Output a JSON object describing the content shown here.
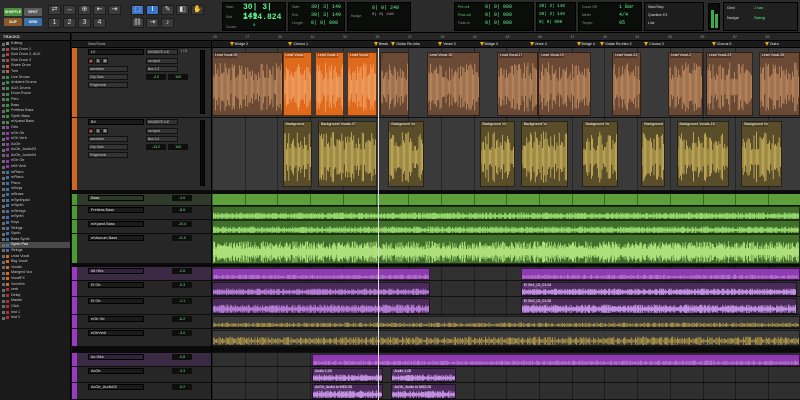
{
  "toolbar": {
    "modes": [
      {
        "label": "SHUFFLE",
        "color": "#4a8f3a"
      },
      {
        "label": "SPOT",
        "color": "#6a6a6a"
      },
      {
        "label": "SLIP",
        "color": "#8a5a2a"
      },
      {
        "label": "GRID",
        "color": "#3a6fa8"
      }
    ],
    "tools": [
      "⇄",
      "↔",
      "⊕",
      "⇤",
      "⇥",
      "⬚",
      "I",
      "✎",
      "◧",
      "✋"
    ],
    "counter_main": "30| 3| 149",
    "counter_sub": "1:14.824",
    "main_label": "Main",
    "sub_label": "Sub",
    "cursor_label": "Cursor",
    "cursor_value": "0",
    "start_label": "Start",
    "end_label": "End",
    "length_label": "Length",
    "start_value": "30| 3| 149",
    "end_value": "30| 3| 149",
    "length_value": "0| 0| 000",
    "nudge_label": "Nudge",
    "nudge_value": "0| 0| 240",
    "preroll_label": "Pre-roll",
    "postroll_label": "Post-roll",
    "fadein_label": "Fade-in",
    "preroll_value": "0| 0| 000",
    "postroll_value": "0| 0| 000",
    "fadein_value": "0| 0| 000",
    "start2_value": "30| 3| 149",
    "end2_value": "30| 3| 149",
    "length2_value": "0| 0| 000",
    "countoff_label": "Count Off",
    "meter_label": "Meter",
    "tempo_label": "Tempo",
    "countoff_value": "1 Bar",
    "meter_value": "4/4",
    "tempo_value": "95",
    "tempo_field": "Tempo ♩",
    "startstop": "Start/Stop",
    "quantize": "Quantize E3",
    "link_label": "Link",
    "grid_label": "Grid",
    "grid_value": "1 bar",
    "nudge2_label": "Nudge",
    "nudge2_value": "Swing"
  },
  "tracks_header": "TRACKS",
  "tracklist": [
    {
      "name": "Editing",
      "color": "#888888"
    },
    {
      "name": "Kick Drum 1",
      "color": "#b04040"
    },
    {
      "name": "Kick Drum 2, AUX",
      "color": "#b04040"
    },
    {
      "name": "Kick Drum 3",
      "color": "#b04040"
    },
    {
      "name": "Snare Drum",
      "color": "#c06030"
    },
    {
      "name": "Tom",
      "color": "#c06030"
    },
    {
      "name": "Live Drums",
      "color": "#2f8f3f"
    },
    {
      "name": "Ambient Drums",
      "color": "#2f8f3f"
    },
    {
      "name": "AUX Drums",
      "color": "#2f8f3f"
    },
    {
      "name": "Drum Room",
      "color": "#2f8f3f"
    },
    {
      "name": "Perc",
      "color": "#2f8f3f"
    },
    {
      "name": "Bass",
      "color": "#3b8f3b"
    },
    {
      "name": "Fretless Bass",
      "color": "#3b8f3b"
    },
    {
      "name": "Synth Bass",
      "color": "#3b8f3b"
    },
    {
      "name": "mXpand Bass",
      "color": "#3b8f3b"
    },
    {
      "name": "Gtrs",
      "color": "#8a3aa0"
    },
    {
      "name": "eGtr Gtr",
      "color": "#8a3aa0"
    },
    {
      "name": "eGtr Verb",
      "color": "#8a3aa0"
    },
    {
      "name": "AcGtr",
      "color": "#8a3aa0"
    },
    {
      "name": "AcGtr_Audio03",
      "color": "#8a3aa0"
    },
    {
      "name": "AcGtr_Audio04",
      "color": "#8a3aa0"
    },
    {
      "name": "eGtr Gtr",
      "color": "#8a3aa0"
    },
    {
      "name": "eKit Verb",
      "color": "#8a3aa0"
    },
    {
      "name": "mPiano",
      "color": "#3a6fb0"
    },
    {
      "name": "mPiano",
      "color": "#3a6fb0"
    },
    {
      "name": "Piano",
      "color": "#3a6fb0"
    },
    {
      "name": "mKeys",
      "color": "#3a6fb0"
    },
    {
      "name": "mBrass",
      "color": "#3a6fb0"
    },
    {
      "name": "mSynthpad",
      "color": "#3a6fb0"
    },
    {
      "name": "mSynth",
      "color": "#3a6fb0"
    },
    {
      "name": "mStrings",
      "color": "#3a6fb0"
    },
    {
      "name": "mSynth",
      "color": "#3a6fb0"
    },
    {
      "name": "Keys",
      "color": "#3a6fb0"
    },
    {
      "name": "Strings",
      "color": "#3a6fb0"
    },
    {
      "name": "Synth",
      "color": "#3a6fb0"
    },
    {
      "name": "Bass Synth",
      "color": "#3a6fb0"
    },
    {
      "name": "Synth Pad",
      "color": "#3a6fb0"
    },
    {
      "name": "Strings",
      "color": "#3a6fb0"
    },
    {
      "name": "Lead Vocal",
      "color": "#d06a20"
    },
    {
      "name": "Bkg Vocal",
      "color": "#d06a20"
    },
    {
      "name": "Vocals",
      "color": "#d06a20"
    },
    {
      "name": "Mangled Vox",
      "color": "#d06a20"
    },
    {
      "name": "VocalFX",
      "color": "#d06a20"
    },
    {
      "name": "VoxVerb",
      "color": "#d06a20"
    },
    {
      "name": "verb",
      "color": "#aa3030"
    },
    {
      "name": "Delay",
      "color": "#aa3030"
    },
    {
      "name": "Master",
      "color": "#aa3030"
    },
    {
      "name": "Click",
      "color": "#aa3030"
    },
    {
      "name": "Inst 1",
      "color": "#aa3030"
    },
    {
      "name": "Inst 2",
      "color": "#aa3030"
    }
  ],
  "selected_track_index": 36,
  "ruler": {
    "bars": [
      "25",
      "27",
      "29",
      "31",
      "33",
      "35",
      "37",
      "39",
      "41",
      "43",
      "45",
      "47",
      "49",
      "51",
      "53",
      "55",
      "57",
      "59"
    ]
  },
  "session_header": {
    "label": "Sets/Shots",
    "sub": "Markers"
  },
  "markers": [
    {
      "label": "Bridge 2",
      "pos": 0.03
    },
    {
      "label": "Chorus 1",
      "pos": 0.13
    },
    {
      "label": "Break",
      "pos": 0.275
    },
    {
      "label": "Guitar Re-intro",
      "pos": 0.305
    },
    {
      "label": "Verse 3",
      "pos": 0.385
    },
    {
      "label": "Bridge 3",
      "pos": 0.455
    },
    {
      "label": "Verse 4",
      "pos": 0.54
    },
    {
      "label": "Bridge 4",
      "pos": 0.62
    },
    {
      "label": "Guitar Re-intro 2",
      "pos": 0.66
    },
    {
      "label": "Chorus 3",
      "pos": 0.735
    },
    {
      "label": "Chorus 5",
      "pos": 0.85
    },
    {
      "label": "Outro",
      "pos": 0.94
    }
  ],
  "track_headers": {
    "lead": {
      "name": "LV",
      "label": "Lead Vocal",
      "insert": "MX4D97E.V-E",
      "io": "I / O",
      "ctrl": "waveform",
      "ctrl2": "Clip Gain",
      "ctrl3": "Polyphonic",
      "out": "no input",
      "out2": "Bus 1-2",
      "vol": "-4.0",
      "pan": "100"
    },
    "bkg": {
      "name": "BV",
      "label": "Background Vocals",
      "insert": "MX4D97E.V-E",
      "ctrl": "waveform",
      "ctrl2": "Clip Gain",
      "ctrl3": "Polyphonic",
      "out": "no input",
      "out2": "Bus 3-4",
      "vol": "-13.2",
      "pan": "100"
    },
    "bass_folder": {
      "name": "Bass",
      "vol": "-4.6"
    },
    "fretless": {
      "name": "Fretless Bass",
      "vol": "-8.6"
    },
    "mxpand": {
      "name": "mXpand Bass",
      "vol": "-10.4"
    },
    "mxpand2": {
      "name": "mVaccum Bass",
      "vol": "-11.0"
    },
    "gtr_folder": {
      "name": "All Gtrs",
      "vol": "-2.6"
    },
    "egtr": {
      "name": "El Gtr",
      "vol": "-5.3"
    },
    "egtr2": {
      "name": "El Gtr",
      "vol": "-1.1"
    },
    "egtr3": {
      "name": "eGtr Gtr",
      "vol": "-6.2"
    },
    "egtrverb": {
      "name": "eGtrVerb",
      "vol": "-3.0"
    },
    "ac_folder": {
      "name": "Ac Gtrs",
      "vol": "-0.8"
    },
    "acgtr": {
      "name": "AcGtr",
      "vol": "-3.3"
    },
    "acgtr2": {
      "name": "AcGtr_Audio03",
      "vol": "-5.2"
    }
  },
  "clips": {
    "lead": [
      {
        "name": "Lead Vocal-09",
        "x": 0.0,
        "w": 0.12,
        "sel": false
      },
      {
        "name": "Lead Vocal-",
        "x": 0.12,
        "w": 0.05,
        "sel": true
      },
      {
        "name": "Lead Vocal-1",
        "x": 0.175,
        "w": 0.05,
        "sel": true
      },
      {
        "name": "Lead Vocal-",
        "x": 0.23,
        "w": 0.05,
        "sel": true
      },
      {
        "name": "",
        "x": 0.285,
        "w": 0.05,
        "sel": false
      },
      {
        "name": "Lead Vocal-15",
        "x": 0.365,
        "w": 0.09,
        "sel": false
      },
      {
        "name": "Lead Vocal-17",
        "x": 0.485,
        "w": 0.07,
        "sel": false
      },
      {
        "name": "Lead Vocal-19",
        "x": 0.555,
        "w": 0.09,
        "sel": false
      },
      {
        "name": "Lead Vocal-21",
        "x": 0.68,
        "w": 0.05,
        "sel": false
      },
      {
        "name": "Lead Vocal-2",
        "x": 0.775,
        "w": 0.06,
        "sel": false
      },
      {
        "name": "Lead Vocal-23",
        "x": 0.84,
        "w": 0.08,
        "sel": false
      },
      {
        "name": "Lead Vocal-25",
        "x": 0.93,
        "w": 0.07,
        "sel": false
      }
    ],
    "bkg": [
      {
        "name": "Background",
        "x": 0.12,
        "w": 0.05
      },
      {
        "name": "Background Vocals-07",
        "x": 0.18,
        "w": 0.1
      },
      {
        "name": "Background Vo",
        "x": 0.3,
        "w": 0.06
      },
      {
        "name": "Background Vo",
        "x": 0.455,
        "w": 0.06
      },
      {
        "name": "Background Vo",
        "x": 0.525,
        "w": 0.08
      },
      {
        "name": "Background Vo",
        "x": 0.63,
        "w": 0.06
      },
      {
        "name": "Background Vo",
        "x": 0.73,
        "w": 0.04
      },
      {
        "name": "Background Vocals-18",
        "x": 0.79,
        "w": 0.09
      },
      {
        "name": "Background Vo",
        "x": 0.9,
        "w": 0.07
      }
    ],
    "gtr": [
      {
        "name": "El Gtr1_01_01-04",
        "x": 0.525,
        "w": 0.47
      },
      {
        "name": "El Gtr2_01_01-05",
        "x": 0.525,
        "w": 0.47
      }
    ],
    "ac": [
      {
        "name": "Audio 1-04",
        "x": 0.17,
        "w": 0.12
      },
      {
        "name": "Audio 1-05",
        "x": 0.305,
        "w": 0.11
      },
      {
        "name": "AcGtr_Audio to MIDI-05",
        "x": 0.17,
        "w": 0.12
      },
      {
        "name": "AcGtr_Audio to MIDI-05",
        "x": 0.305,
        "w": 0.11
      }
    ]
  },
  "colors": {
    "vocal_clip": "#b97a4a",
    "vocal_sel": "#e06a1c",
    "bkg_clip": "#c9a94a",
    "bass_clip": "#5aa03a",
    "gtr_clip": "#8e3ab0",
    "accent": "#3c74c6",
    "lcd": "#5ef08a"
  }
}
